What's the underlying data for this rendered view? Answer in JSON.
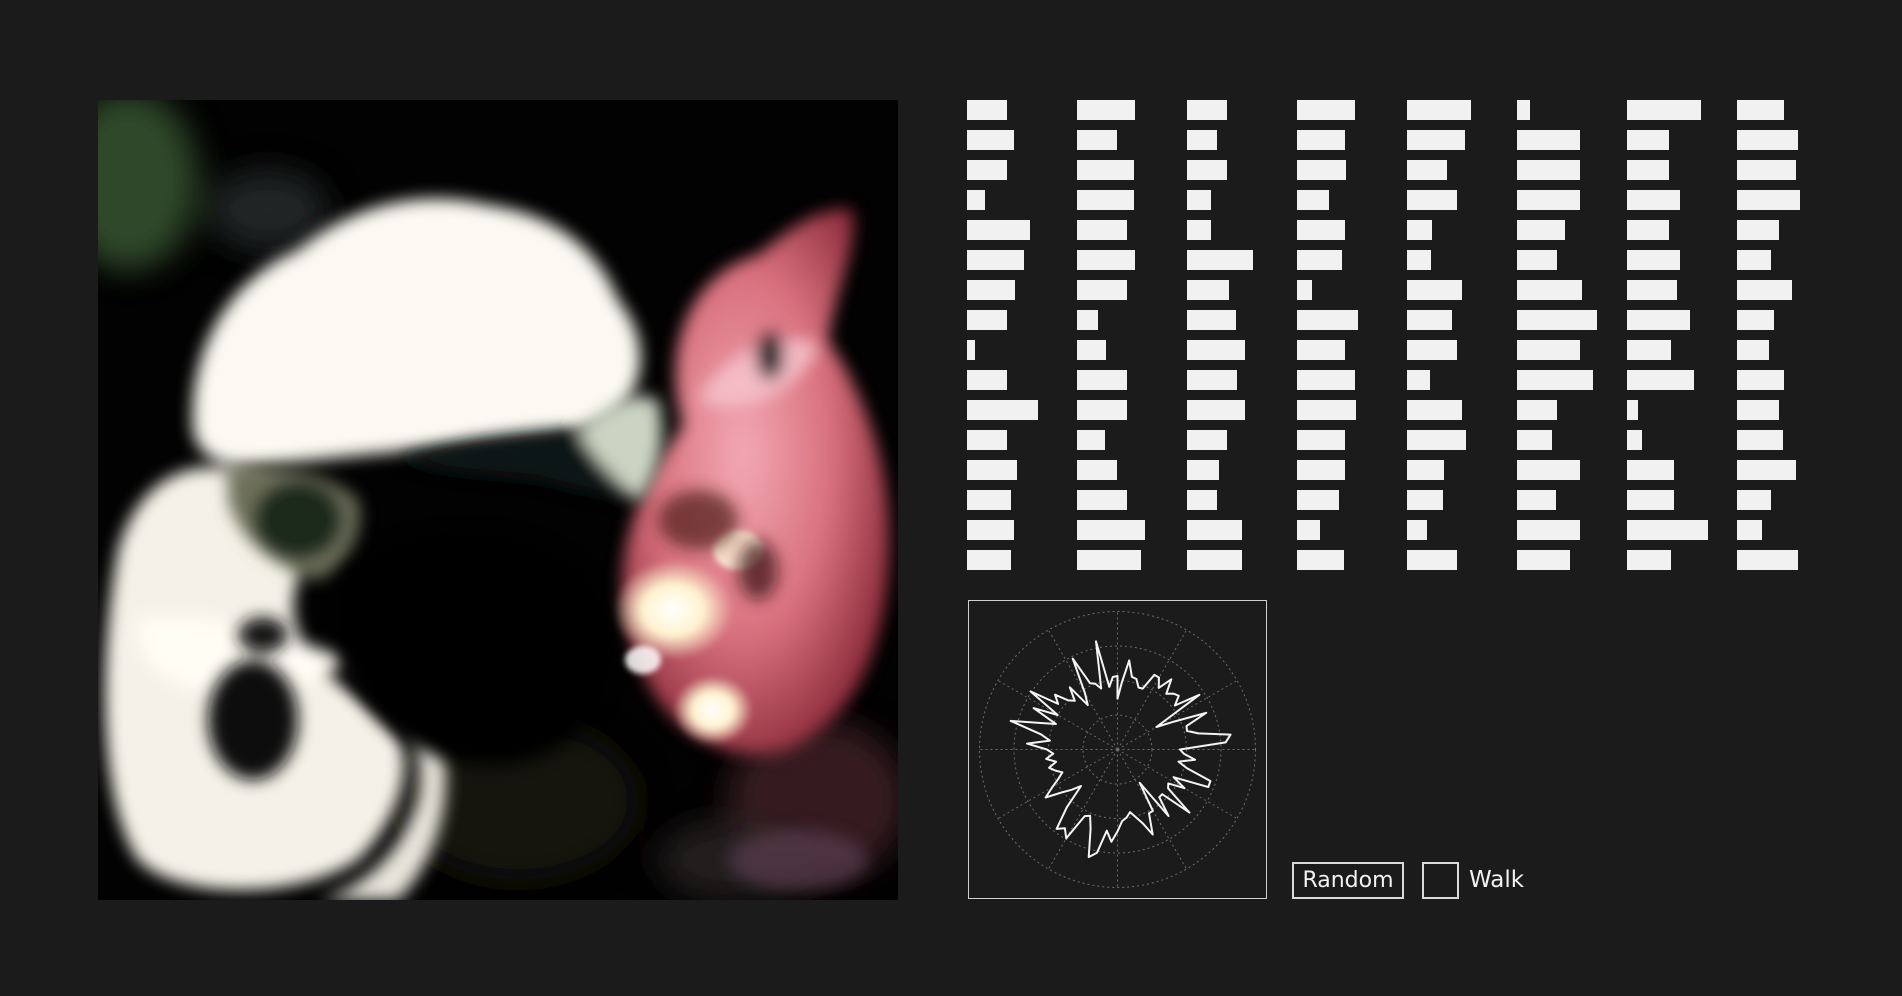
{
  "controls": {
    "random_label": "Random",
    "walk_label": "Walk",
    "walk_checked": false
  },
  "colors": {
    "background": "#1b1b1b",
    "bar": "#f1f1f1",
    "outline": "#d9d9d9"
  },
  "latent_vector": {
    "columns": 8,
    "rows": 16,
    "values": [
      [
        0.38,
        0.45,
        0.38,
        0.17,
        0.6,
        0.54,
        0.46,
        0.38,
        0.08,
        0.38,
        0.68,
        0.38,
        0.48,
        0.42,
        0.45,
        0.42
      ],
      [
        0.55,
        0.38,
        0.54,
        0.54,
        0.48,
        0.55,
        0.48,
        0.2,
        0.28,
        0.48,
        0.48,
        0.27,
        0.38,
        0.48,
        0.65,
        0.61
      ],
      [
        0.38,
        0.29,
        0.38,
        0.23,
        0.23,
        0.63,
        0.4,
        0.47,
        0.55,
        0.48,
        0.55,
        0.38,
        0.3,
        0.29,
        0.52,
        0.52
      ],
      [
        0.55,
        0.46,
        0.47,
        0.3,
        0.46,
        0.43,
        0.14,
        0.58,
        0.46,
        0.55,
        0.56,
        0.46,
        0.46,
        0.4,
        0.22,
        0.45
      ],
      [
        0.61,
        0.55,
        0.38,
        0.48,
        0.24,
        0.23,
        0.52,
        0.43,
        0.48,
        0.22,
        0.52,
        0.56,
        0.35,
        0.34,
        0.19,
        0.48
      ],
      [
        0.12,
        0.6,
        0.6,
        0.6,
        0.46,
        0.38,
        0.62,
        0.76,
        0.6,
        0.72,
        0.38,
        0.33,
        0.6,
        0.37,
        0.6,
        0.5
      ],
      [
        0.7,
        0.4,
        0.4,
        0.5,
        0.4,
        0.5,
        0.48,
        0.6,
        0.42,
        0.64,
        0.1,
        0.14,
        0.45,
        0.45,
        0.77,
        0.42
      ],
      [
        0.45,
        0.58,
        0.56,
        0.6,
        0.4,
        0.32,
        0.52,
        0.35,
        0.3,
        0.45,
        0.4,
        0.44,
        0.56,
        0.32,
        0.24,
        0.58
      ]
    ]
  },
  "latent_radar": {
    "points": 96,
    "rings": 4,
    "spokes": 12
  }
}
